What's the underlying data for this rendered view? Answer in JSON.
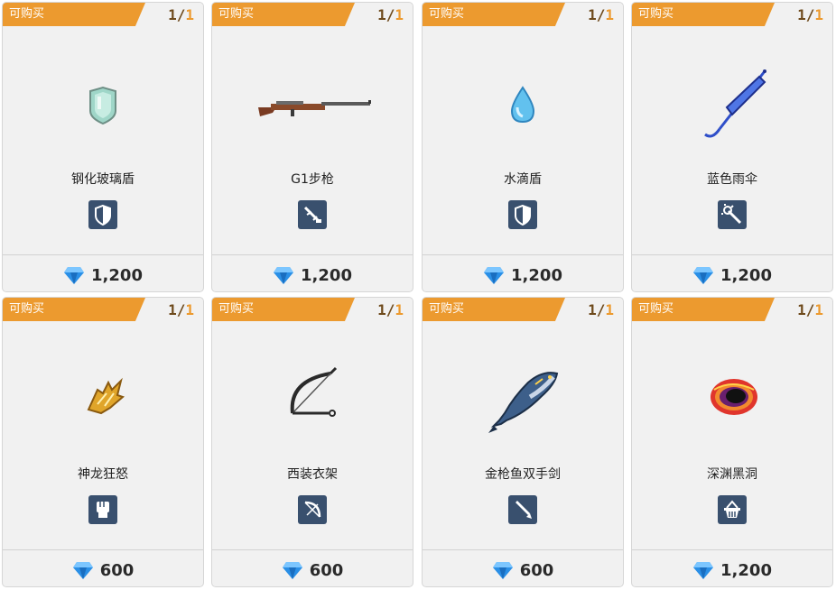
{
  "shop": {
    "items": [
      {
        "badge": "可购买",
        "bought": "1",
        "sep": "/",
        "limit": "1",
        "name": "钢化玻璃盾",
        "category": "shield-icon",
        "art": "glass-shield",
        "price": "1,200"
      },
      {
        "badge": "可购买",
        "bought": "1",
        "sep": "/",
        "limit": "1",
        "name": "G1步枪",
        "category": "rifle-icon",
        "art": "rifle",
        "price": "1,200"
      },
      {
        "badge": "可购买",
        "bought": "1",
        "sep": "/",
        "limit": "1",
        "name": "水滴盾",
        "category": "shield-icon",
        "art": "water-drop",
        "price": "1,200"
      },
      {
        "badge": "可购买",
        "bought": "1",
        "sep": "/",
        "limit": "1",
        "name": "蓝色雨伞",
        "category": "wand-icon",
        "art": "umbrella",
        "price": "1,200"
      },
      {
        "badge": "可购买",
        "bought": "1",
        "sep": "/",
        "limit": "1",
        "name": "神龙狂怒",
        "category": "fist-icon",
        "art": "dragon-claw",
        "price": "600"
      },
      {
        "badge": "可购买",
        "bought": "1",
        "sep": "/",
        "limit": "1",
        "name": "西装衣架",
        "category": "bow-icon",
        "art": "hanger-bow",
        "price": "600"
      },
      {
        "badge": "可购买",
        "bought": "1",
        "sep": "/",
        "limit": "1",
        "name": "金枪鱼双手剑",
        "category": "sword-icon",
        "art": "tuna",
        "price": "600"
      },
      {
        "badge": "可购买",
        "bought": "1",
        "sep": "/",
        "limit": "1",
        "name": "深渊黑洞",
        "category": "basket-icon",
        "art": "black-hole",
        "price": "1,200"
      }
    ]
  },
  "colors": {
    "badge": "#ec9a2f",
    "category_bg": "#39506e",
    "gem": "#2a8fe6"
  }
}
